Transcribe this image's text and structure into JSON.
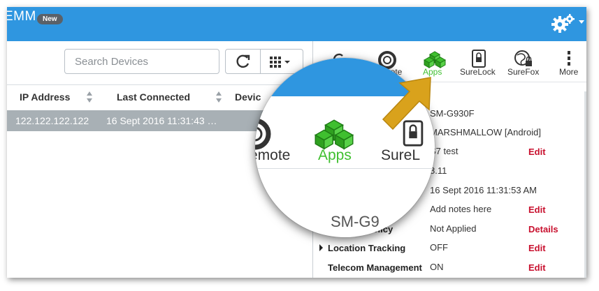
{
  "header": {
    "app_title": "EMM",
    "new_badge": "New"
  },
  "search": {
    "placeholder": "Search Devices"
  },
  "table": {
    "columns": [
      "IP Address",
      "Last Connected",
      "Devic"
    ],
    "rows": [
      {
        "ip": "122.122.122.122",
        "last_connected": "16 Sept 2016 11:31:43 …"
      }
    ]
  },
  "toolbar": {
    "items": [
      {
        "label": "Remote",
        "icon": "lifebuoy-icon"
      },
      {
        "label": "Apps",
        "icon": "apps-cubes-icon"
      },
      {
        "label": "SureLock",
        "icon": "surelock-icon"
      },
      {
        "label": "SureFox",
        "icon": "surefox-globe-icon"
      },
      {
        "label": "More",
        "icon": "more-vertical-icon"
      }
    ],
    "partial_label": "emote"
  },
  "details": {
    "model": "SM-G930F",
    "os": "MARSHMALLOW [Android]",
    "name": "S7 test",
    "version": "8.11",
    "last_connected_label_partial": "e",
    "last_connected": "16 Sept 2016 11:31:53 AM",
    "notes": "Add notes here",
    "security_policy_label": "Security Policy",
    "security_policy": "Not Applied",
    "location_tracking_label": "Location Tracking",
    "location_tracking": "OFF",
    "telecom_label": "Telecom Management",
    "telecom": "ON",
    "edit_label": "Edit",
    "details_label": "Details"
  },
  "lens": {
    "remote_partial": "emote",
    "apps": "Apps",
    "surelock_partial": "SureL",
    "model_partial": "SM-G9"
  },
  "colors": {
    "header_blue": "#2f96e0",
    "apps_green": "#3fbf2f",
    "link_red": "#c8102e",
    "arrow_gold": "#d9a21c",
    "row_selected": "#a8b0b5"
  }
}
